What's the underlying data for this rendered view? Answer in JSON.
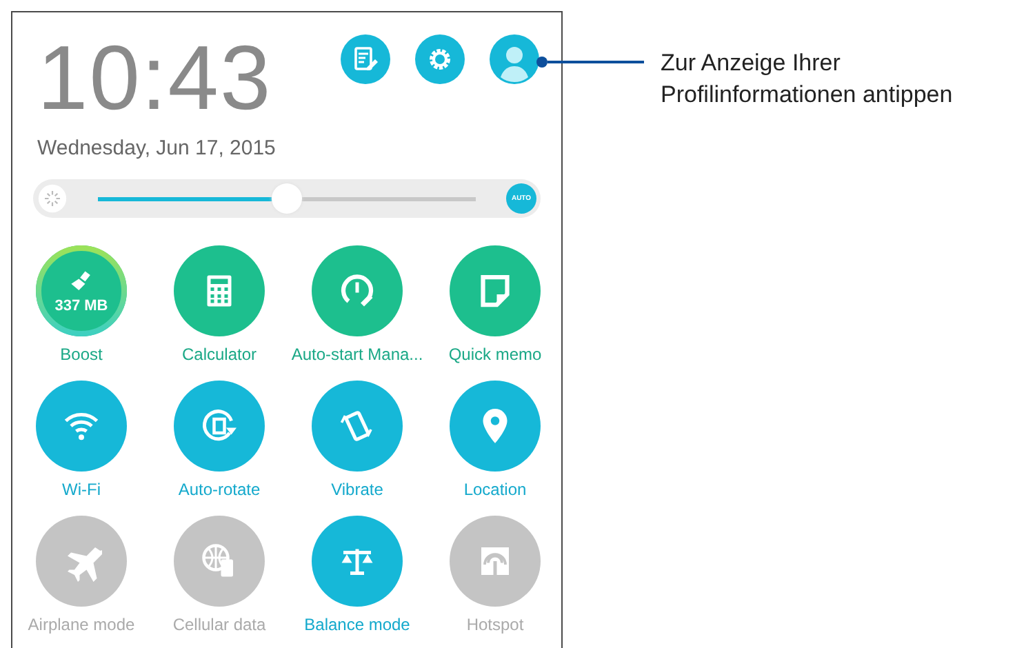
{
  "clock": {
    "time": "10:43",
    "date": "Wednesday, Jun 17, 2015"
  },
  "brightness": {
    "level": 0.5,
    "auto": "AUTO"
  },
  "tiles": [
    {
      "label": "Boost",
      "kind": "app",
      "badge": "337 MB"
    },
    {
      "label": "Calculator",
      "kind": "app"
    },
    {
      "label": "Auto-start Mana...",
      "kind": "app"
    },
    {
      "label": "Quick memo",
      "kind": "app"
    },
    {
      "label": "Wi-Fi",
      "kind": "toggle",
      "on": true
    },
    {
      "label": "Auto-rotate",
      "kind": "toggle",
      "on": true
    },
    {
      "label": "Vibrate",
      "kind": "toggle",
      "on": true
    },
    {
      "label": "Location",
      "kind": "toggle",
      "on": true
    },
    {
      "label": "Airplane mode",
      "kind": "toggle",
      "on": false
    },
    {
      "label": "Cellular data",
      "kind": "toggle",
      "on": false
    },
    {
      "label": "Balance mode",
      "kind": "toggle",
      "on": true
    },
    {
      "label": "Hotspot",
      "kind": "toggle",
      "on": false
    }
  ],
  "callout": {
    "text": "Zur Anzeige Ihrer Profilinformationen antippen"
  }
}
